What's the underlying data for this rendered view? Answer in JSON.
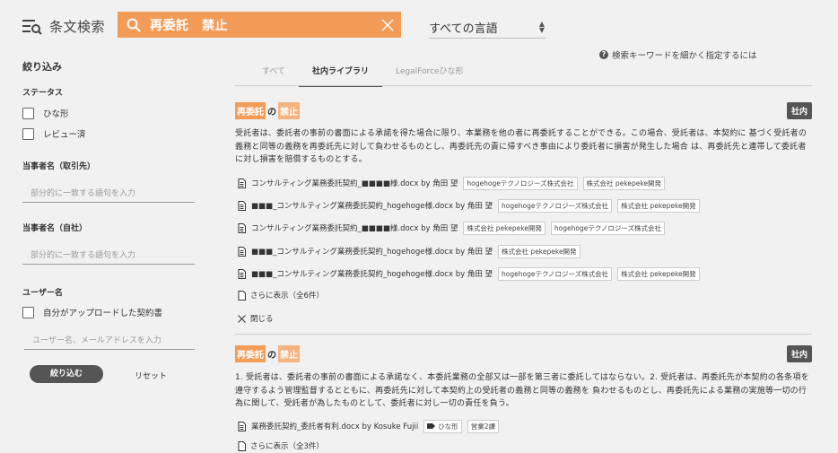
{
  "header": {
    "title": "条文検索",
    "search_value": "再委託　禁止",
    "language": "すべての言語",
    "help_text": "検索キーワードを細かく指定するには"
  },
  "sidebar": {
    "heading": "絞り込み",
    "status_label": "ステータス",
    "status_options": [
      "ひな形",
      "レビュー済"
    ],
    "party_other_label": "当事者名（取引先）",
    "party_other_placeholder": "部分的に一致する語句を入力",
    "party_self_label": "当事者名（自社）",
    "party_self_placeholder": "部分的に一致する語句を入力",
    "user_label": "ユーザー名",
    "user_checkbox": "自分がアップロードした契約書",
    "user_placeholder": "ユーザー名、メールアドレスを入力",
    "apply_button": "絞り込む",
    "reset_button": "リセット"
  },
  "tabs": [
    "すべて",
    "社内ライブラリ",
    "LegalForceひな形"
  ],
  "results": [
    {
      "title_kw1": "再委託",
      "title_sep": "の",
      "title_kw2": "禁止",
      "badge": "社内",
      "body": "受託者は、委託者の事前の書面による承諾を得た場合に限り、本業務を他の者に再委託することができる。この場合、受託者は、本契約に 基づく受託者の義務と同等の義務を再委託先に対して負わせるものとし、再委託先の責に帰すべき事由により委託者に損害が発生した場合 は、再委託先と連帯して委託者に対し損害を賠償するものとする。",
      "docs": [
        {
          "name": "コンサルティング業務委託契約_■■■■様.docx by 角田 望",
          "tags": [
            "hogehogeテクノロジーズ株式会社",
            "株式会社 pekepeke開発"
          ]
        },
        {
          "name": "■■■_コンサルティング業務委託契約_hogehoge様.docx by 角田 望",
          "tags": [
            "hogehogeテクノロジーズ株式会社",
            "株式会社 pekepeke開発"
          ]
        },
        {
          "name": "コンサルティング業務委託契約_■■■■様.docx by 角田 望",
          "tags": [
            "株式会社 pekepeke開発",
            "hogehogeテクノロジーズ株式会社"
          ]
        },
        {
          "name": "■■■_コンサルティング業務委託契約_hogehoge様.docx by 角田 望",
          "tags": [
            "株式会社 pekepeke開発"
          ]
        },
        {
          "name": "■■■_コンサルティング業務委託契約_hogehoge様.docx by 角田 望",
          "tags": [
            "hogehogeテクノロジーズ株式会社",
            "株式会社 pekepeke開発"
          ]
        }
      ],
      "more": "さらに表示（全6件）",
      "close": "閉じる"
    },
    {
      "title_kw1": "再委託",
      "title_sep": "の",
      "title_kw2": "禁止",
      "badge": "社内",
      "body": "1. 受託者は、委託者の事前の書面による承諾なく、本委託業務の全部又は一部を第三者に委託してはならない。2. 受託者は、再委託先が本契約の各条項を遵守するよう管理監督するとともに、再委託先に対して本契約上の受託者の義務と同等の義務を 負わせるものとし、再委託先による業務の実施等一切の行為に関して、受託者が為したものとして、委託者に対し一切の責任を負う。",
      "docs": [
        {
          "name": "業務委託契約_委託者有利.docx by Kosuke Fujii",
          "tags": [
            "ひな形",
            "営業2課"
          ]
        }
      ],
      "more": "さらに表示（全3件）"
    }
  ]
}
